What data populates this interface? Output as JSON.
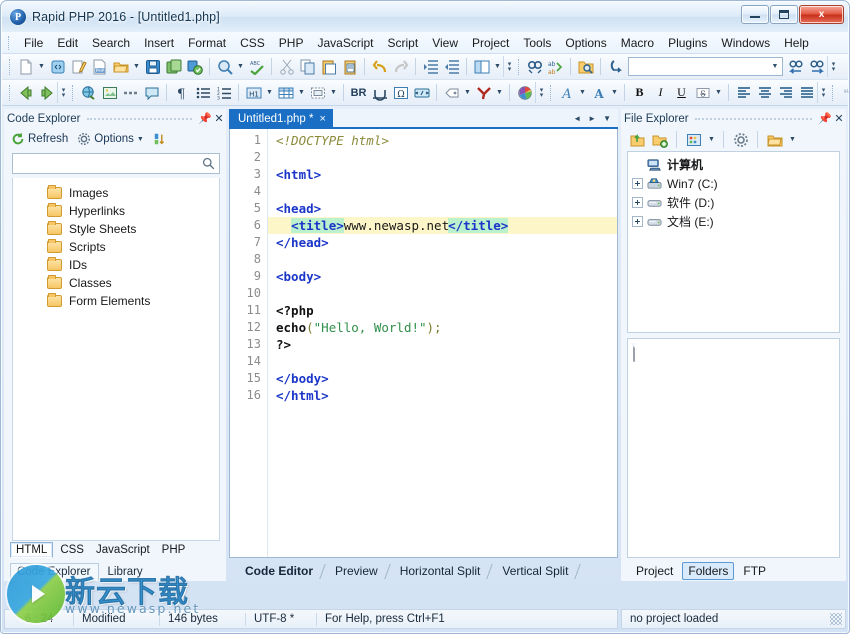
{
  "window": {
    "title": "Rapid PHP 2016 - [Untitled1.php]",
    "app_icon": "rapid-php-logo",
    "minimize_label": "Minimize",
    "maximize_label": "Maximize",
    "close_label": "x"
  },
  "menubar": [
    {
      "label": "File",
      "accel": "F"
    },
    {
      "label": "Edit",
      "accel": "E"
    },
    {
      "label": "Search",
      "accel": "S"
    },
    {
      "label": "Insert",
      "accel": "I"
    },
    {
      "label": "Format",
      "accel": "a"
    },
    {
      "label": "CSS",
      "accel": "C"
    },
    {
      "label": "PHP",
      "accel": ""
    },
    {
      "label": "JavaScript",
      "accel": "J"
    },
    {
      "label": "Script",
      "accel": "r"
    },
    {
      "label": "View",
      "accel": "V"
    },
    {
      "label": "Project",
      "accel": "P"
    },
    {
      "label": "Tools",
      "accel": "T"
    },
    {
      "label": "Options",
      "accel": "O"
    },
    {
      "label": "Macro",
      "accel": "a"
    },
    {
      "label": "Plugins",
      "accel": ""
    },
    {
      "label": "Windows",
      "accel": "W"
    },
    {
      "label": "Help",
      "accel": "H"
    }
  ],
  "toolbar_row1": {
    "search_value": "",
    "search_placeholder": "",
    "items": [
      "new-file-icon",
      "new-file-dropdown",
      "new-from-template-icon",
      "edit-file-icon",
      "new-php-icon",
      "open-folder-icon",
      "open-dropdown",
      "save-icon",
      "save-as-icon",
      "save-all-icon",
      "preview-icon",
      "preview-dropdown",
      "spellcheck-icon",
      "cut-icon",
      "copy-icon",
      "paste-icon",
      "paste-special-icon",
      "undo-icon",
      "redo-icon",
      "indent-icon",
      "outdent-icon",
      "split-view-icon",
      "split-view-dropdown",
      "find-icon",
      "replace-icon",
      "find-in-files-icon",
      "goto-line-icon",
      "find-previous-icon",
      "find-next-icon"
    ]
  },
  "toolbar_row2": {
    "bold_label": "B",
    "italic_label": "I",
    "underline_label": "U",
    "strike_label": "S",
    "br_label": "BR",
    "heading_label": "H1",
    "items": [
      "back-icon",
      "forward-icon",
      "link-icon",
      "image-icon",
      "hr-icon",
      "comment-icon",
      "paragraph-icon",
      "unordered-list-icon",
      "ordered-list-icon",
      "heading-icon",
      "table-icon",
      "layer-icon",
      "br-icon",
      "nbsp-icon",
      "special-char-icon",
      "meta-icon",
      "tag-icon",
      "quick-tag-icon",
      "color-picker-icon",
      "font-icon",
      "font-style-icon",
      "align-left-icon",
      "align-center-icon",
      "align-right-icon",
      "justify-icon",
      "quote-icon"
    ]
  },
  "code_explorer": {
    "title": "Code Explorer",
    "pin_icon": "pin-icon",
    "close_icon": "close-icon",
    "refresh_label": "Refresh",
    "options_label": "Options",
    "sort_icon": "sort-az-icon",
    "search_value": "",
    "search_placeholder": "",
    "tree": [
      {
        "label": "Images",
        "icon": "folder-icon"
      },
      {
        "label": "Hyperlinks",
        "icon": "folder-icon"
      },
      {
        "label": "Style Sheets",
        "icon": "folder-icon"
      },
      {
        "label": "Scripts",
        "icon": "folder-icon"
      },
      {
        "label": "IDs",
        "icon": "folder-icon"
      },
      {
        "label": "Classes",
        "icon": "folder-icon"
      },
      {
        "label": "Form Elements",
        "icon": "folder-icon"
      }
    ],
    "language_tabs": [
      {
        "label": "HTML",
        "active": true
      },
      {
        "label": "CSS",
        "active": false
      },
      {
        "label": "JavaScript",
        "active": false
      },
      {
        "label": "PHP",
        "active": false
      }
    ],
    "panel_tabs": [
      {
        "label": "Code Explorer",
        "active": true
      },
      {
        "label": "Library",
        "active": false
      }
    ]
  },
  "editor": {
    "tab_label": "Untitled1.php *",
    "tab_close": "×",
    "nav_prev": "◄",
    "nav_next": "►",
    "nav_list": "▼",
    "highlight_line": 6,
    "lines": [
      {
        "n": 1,
        "tokens": [
          {
            "t": "doctype",
            "v": "<!DOCTYPE html>"
          }
        ]
      },
      {
        "n": 2,
        "tokens": []
      },
      {
        "n": 3,
        "tokens": [
          {
            "t": "tag",
            "v": "<html>"
          }
        ]
      },
      {
        "n": 4,
        "tokens": []
      },
      {
        "n": 5,
        "tokens": [
          {
            "t": "tag",
            "v": "<head>"
          }
        ]
      },
      {
        "n": 6,
        "tokens": [
          {
            "t": "plain",
            "v": "  "
          },
          {
            "t": "tagmatch",
            "v": "<title>"
          },
          {
            "t": "text",
            "v": "www.newasp.net"
          },
          {
            "t": "caret",
            "v": ""
          },
          {
            "t": "tagmatch",
            "v": "</title>"
          }
        ]
      },
      {
        "n": 7,
        "tokens": [
          {
            "t": "tag",
            "v": "</head>"
          }
        ]
      },
      {
        "n": 8,
        "tokens": []
      },
      {
        "n": 9,
        "tokens": [
          {
            "t": "tag",
            "v": "<body>"
          }
        ]
      },
      {
        "n": 10,
        "tokens": []
      },
      {
        "n": 11,
        "tokens": [
          {
            "t": "php",
            "v": "<?php"
          }
        ]
      },
      {
        "n": 12,
        "tokens": [
          {
            "t": "fn",
            "v": "echo"
          },
          {
            "t": "punct",
            "v": "("
          },
          {
            "t": "str",
            "v": "\"Hello, World!\""
          },
          {
            "t": "punct",
            "v": ");"
          }
        ]
      },
      {
        "n": 13,
        "tokens": [
          {
            "t": "php",
            "v": "?>"
          }
        ]
      },
      {
        "n": 14,
        "tokens": []
      },
      {
        "n": 15,
        "tokens": [
          {
            "t": "tag",
            "v": "</body>"
          }
        ]
      },
      {
        "n": 16,
        "tokens": [
          {
            "t": "tag",
            "v": "</html>"
          }
        ]
      }
    ],
    "view_tabs": [
      {
        "label": "Code Editor",
        "active": true
      },
      {
        "label": "Preview",
        "active": false
      },
      {
        "label": "Horizontal Split",
        "active": false
      },
      {
        "label": "Vertical Split",
        "active": false
      }
    ]
  },
  "file_explorer": {
    "title": "File Explorer",
    "pin_icon": "pin-icon",
    "close_icon": "close-icon",
    "toolbar_icons": [
      "open-file-icon",
      "add-folder-icon",
      "view-mode-icon",
      "view-mode-dropdown",
      "settings-icon",
      "folder-browse-icon",
      "folder-browse-dropdown"
    ],
    "tree": [
      {
        "label": "计算机",
        "icon": "computer-icon",
        "expander": false,
        "bold": true
      },
      {
        "label": "Win7 (C:)",
        "icon": "system-drive-icon",
        "expander": true,
        "bold": false
      },
      {
        "label": "软件 (D:)",
        "icon": "drive-icon",
        "expander": true,
        "bold": false
      },
      {
        "label": "文档 (E:)",
        "icon": "drive-icon",
        "expander": true,
        "bold": false
      }
    ],
    "preview_icon": "document-icon",
    "panel_tabs": [
      {
        "label": "Project",
        "active": false
      },
      {
        "label": "Folders",
        "active": true
      },
      {
        "label": "FTP",
        "active": false
      }
    ]
  },
  "statusbar": {
    "cursor": "6 : 24",
    "modified": "Modified",
    "size": "146 bytes",
    "encoding": "UTF-8 *",
    "help": "For Help, press Ctrl+F1",
    "project": "no project loaded"
  },
  "watermark": {
    "text_cn": "新云下载",
    "url": "www.newasp.net",
    "logo": "newasp-logo"
  },
  "colors": {
    "accent": "#1a6fc4",
    "titlebar": "#dceaf8",
    "close_button": "#c8311c",
    "highlight_line": "#fcf6c8",
    "tag_match": "#bdf0cd",
    "tag": "#1a35c8",
    "string": "#2f8f4a",
    "doctype": "#8a8a3a",
    "folder": "#f7c565"
  }
}
